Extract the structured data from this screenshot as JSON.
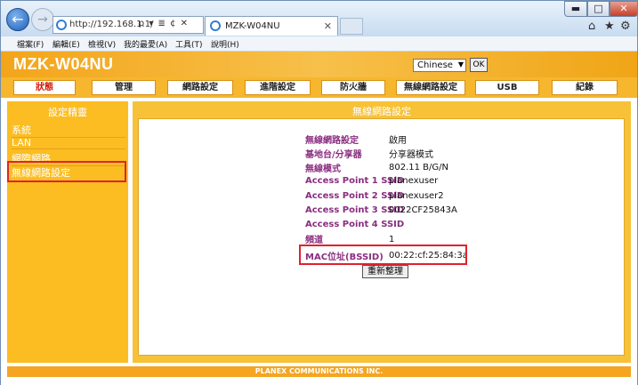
{
  "browser": {
    "address_url": "http://192.168.1.1/",
    "address_tools": "ρ ▾ ≣ ¢ ✕",
    "tab_title": "MZK-W04NU",
    "tab_close": "✕",
    "window_controls": {
      "minimize": "▬",
      "maximize": "□",
      "close": "✕"
    },
    "right_icons": {
      "home": "⌂",
      "favorites": "★",
      "settings": "⚙"
    },
    "menu": [
      "檔案(F)",
      "編輯(E)",
      "檢視(V)",
      "我的最愛(A)",
      "工具(T)",
      "說明(H)"
    ]
  },
  "router": {
    "logo": "MZK-W04NU",
    "language_selected": "Chinese",
    "ok_label": "OK",
    "nav_tabs": [
      "狀態",
      "管理",
      "網路設定",
      "進階設定",
      "防火牆",
      "無線網路設定",
      "USB",
      "紀錄"
    ],
    "sidebar": {
      "title": "設定精靈",
      "items": [
        "系統",
        "LAN",
        "網際網路",
        "無線網路設定"
      ]
    },
    "main_title": "無線網路設定",
    "rows": [
      {
        "label": "無線網路設定",
        "value": "啟用"
      },
      {
        "label": "基地台/分享器",
        "value": "分享器模式"
      },
      {
        "label": "無線模式",
        "value": "802.11 B/G/N"
      },
      {
        "label": "Access Point 1 SSID",
        "value": "planexuser"
      },
      {
        "label": "Access Point 2 SSID",
        "value": "planexuser2"
      },
      {
        "label": "Access Point 3 SSID",
        "value": "0022CF25843A"
      },
      {
        "label": "Access Point 4 SSID",
        "value": ""
      },
      {
        "label": "頻道",
        "value": "1"
      },
      {
        "label": "MAC位址(BSSID)",
        "value": "00:22:cf:25:84:3a"
      }
    ],
    "refresh_label": "重新整理",
    "footer": "PLANEX COMMUNICATIONS INC."
  },
  "colors": {
    "header_orange": "#f3a51a",
    "label_purple": "#8a2e80",
    "highlight_red": "#e0222c"
  }
}
